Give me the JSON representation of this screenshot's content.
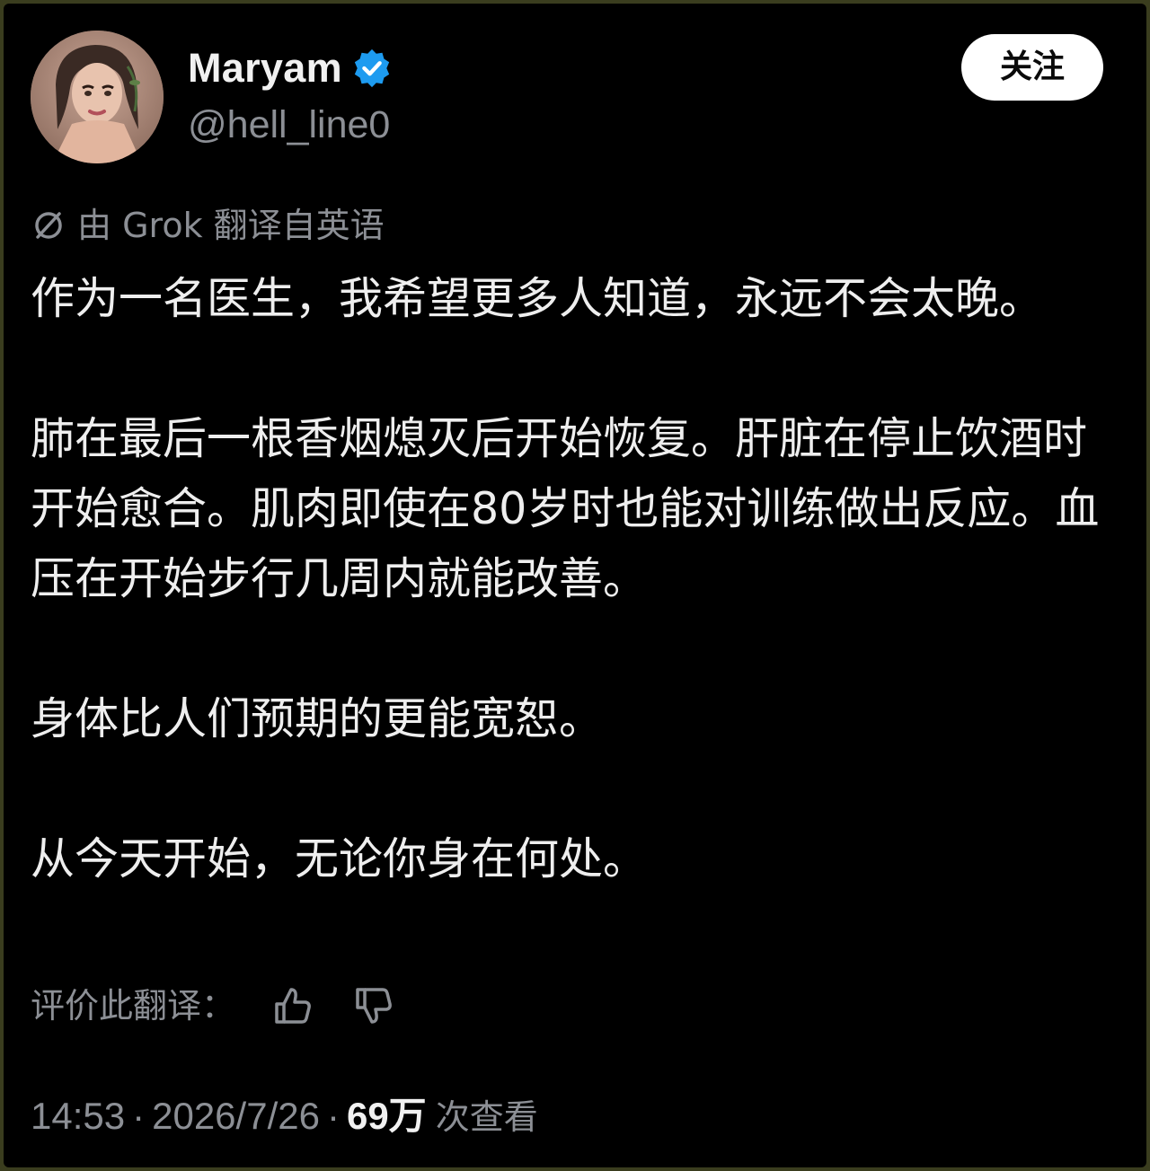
{
  "user": {
    "display_name": "Maryam",
    "handle": "@hell_line0",
    "verified_icon": "verified-badge-icon",
    "verified_color": "#1d9bf0"
  },
  "follow_button": {
    "label": "关注"
  },
  "translation": {
    "icon": "grok-icon",
    "note": "由 Grok 翻译自英语"
  },
  "post": {
    "paragraphs": [
      "作为一名医生，我希望更多人知道，永远不会太晚。",
      "肺在最后一根香烟熄灭后开始恢复。肝脏在停止饮酒时开始愈合。肌肉即使在80岁时也能对训练做出反应。血压在开始步行几周内就能改善。",
      "身体比人们预期的更能宽恕。",
      "从今天开始，无论你身在何处。"
    ]
  },
  "rating": {
    "label": "评价此翻译：",
    "thumbs_up_icon": "thumbs-up-icon",
    "thumbs_down_icon": "thumbs-down-icon"
  },
  "meta": {
    "time": "14:53",
    "separator": "·",
    "date": "2026/7/26",
    "views_count": "69万",
    "views_label": "次查看"
  },
  "colors": {
    "background": "#000000",
    "primary_text": "#eeeeee",
    "secondary_text": "#8c8f95",
    "button_bg": "#ffffff"
  }
}
